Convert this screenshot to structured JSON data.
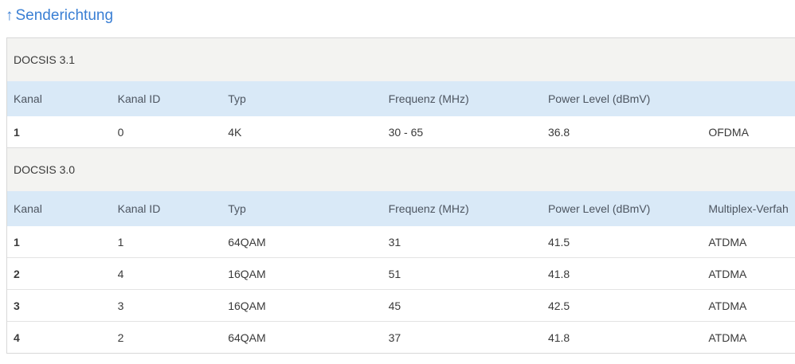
{
  "header": {
    "arrow": "↑",
    "link": "Senderichtung"
  },
  "columns": {
    "kanal": "Kanal",
    "kanal_id": "Kanal ID",
    "typ": "Typ",
    "frequenz": "Frequenz (MHz)",
    "power": "Power Level (dBmV)",
    "multiplex": "Multiplex-Verfah"
  },
  "docsis31": {
    "title": "DOCSIS 3.1",
    "rows": [
      [
        "1",
        "0",
        "4K",
        "30 - 65",
        "36.8",
        "OFDMA"
      ]
    ]
  },
  "docsis30": {
    "title": "DOCSIS 3.0",
    "rows": [
      [
        "1",
        "1",
        "64QAM",
        "31",
        "41.5",
        "ATDMA"
      ],
      [
        "2",
        "4",
        "16QAM",
        "51",
        "41.8",
        "ATDMA"
      ],
      [
        "3",
        "3",
        "16QAM",
        "45",
        "42.5",
        "ATDMA"
      ],
      [
        "4",
        "2",
        "64QAM",
        "37",
        "41.8",
        "ATDMA"
      ]
    ]
  }
}
